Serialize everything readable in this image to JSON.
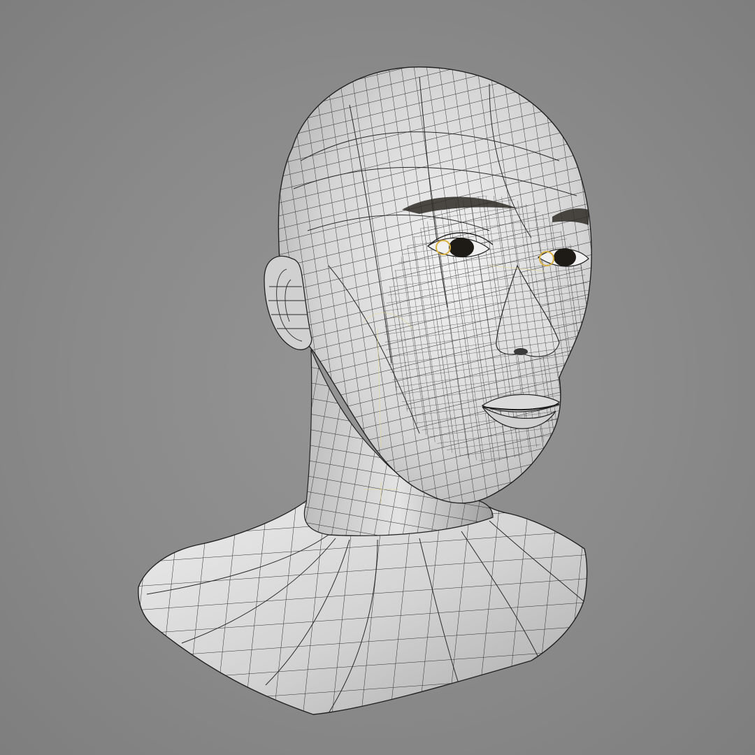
{
  "scene": {
    "background_color": "#8a8a8a",
    "mesh_fill_color": "#d9d9d9",
    "wire_color": "#2a2a2a",
    "eye_ring_color": "#d8b040",
    "helper_line_color": "#e6d890",
    "brow_color": "#2e2a26",
    "iris_color": "#1e1a16",
    "shading": "wireframe-on-shaded"
  }
}
